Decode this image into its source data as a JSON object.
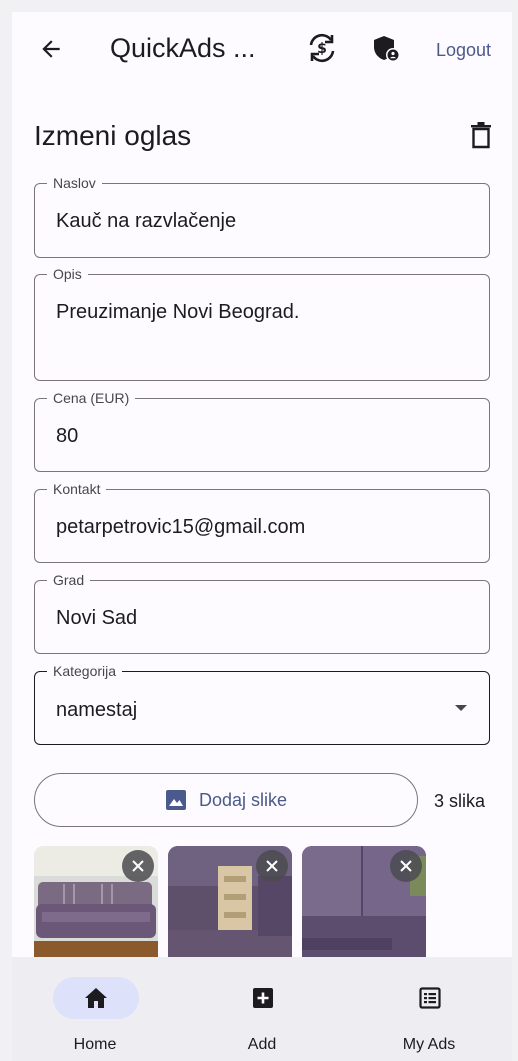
{
  "appbar": {
    "title": "QuickAds ...",
    "logout_label": "Logout"
  },
  "page": {
    "title": "Izmeni oglas"
  },
  "form": {
    "title_label": "Naslov",
    "title_value": "Kauč na razvlačenje",
    "description_label": "Opis",
    "description_value": "Preuzimanje Novi Beograd.",
    "price_label": "Cena (EUR)",
    "price_value": "80",
    "contact_label": "Kontakt",
    "contact_value": "petarpetrovic15@gmail.com",
    "city_label": "Grad",
    "city_value": "Novi Sad",
    "category_label": "Kategorija",
    "category_value": "namestaj"
  },
  "images": {
    "add_label": "Dodaj slike",
    "count_label": "3 slika"
  },
  "bottom_nav": {
    "items": [
      {
        "label": "Home",
        "icon": "home-icon",
        "active": true
      },
      {
        "label": "Add",
        "icon": "add-box-icon",
        "active": false
      },
      {
        "label": "My Ads",
        "icon": "list-icon",
        "active": false
      }
    ]
  },
  "colors": {
    "accent": "#4b5a8c",
    "nav_active_pill": "#dde1f9",
    "nav_background": "#eeeef2",
    "background": "#fdfbff"
  }
}
